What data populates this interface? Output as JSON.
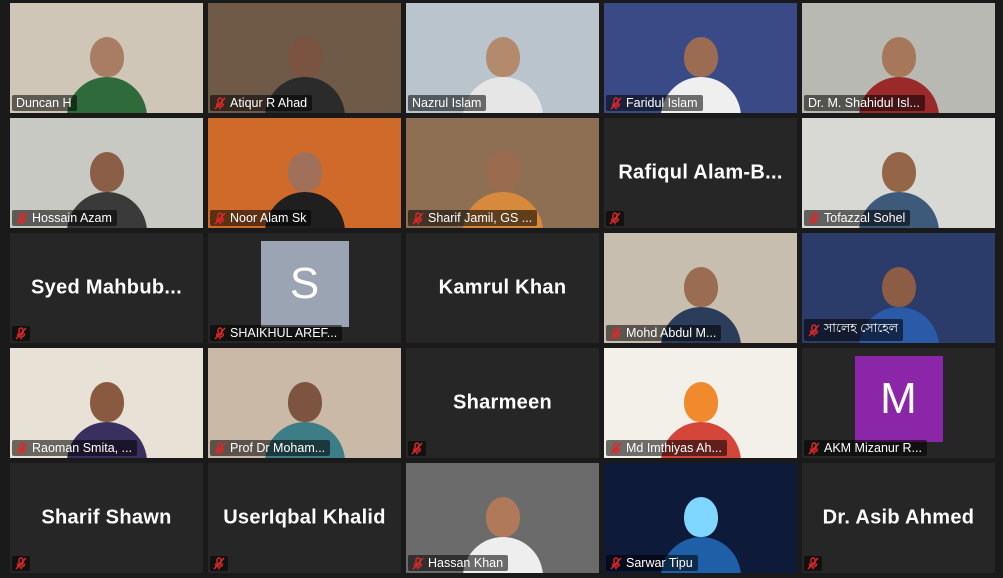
{
  "meeting": {
    "colors": {
      "active_speaker_border": "#d6e07a",
      "muted_icon": "#e02828",
      "tile_background": "#262626"
    },
    "participants": [
      {
        "name": "Duncan H",
        "label": "Duncan H",
        "video": true,
        "muted": false,
        "active_speaker": true,
        "scene": {
          "bg": "#cfc6b8",
          "head": "#a97c64",
          "body": "#2f6a3a"
        }
      },
      {
        "name": "Atiqur R Ahad",
        "label": "Atiqur R Ahad",
        "video": true,
        "muted": true,
        "scene": {
          "bg": "#6f5a48",
          "head": "#7a5440",
          "body": "#2b2b2b"
        }
      },
      {
        "name": "Nazrul Islam",
        "label": "Nazrul Islam",
        "video": true,
        "muted": false,
        "scene": {
          "bg": "#b9c4cc",
          "head": "#b48a6c",
          "body": "#e6e6e6"
        }
      },
      {
        "name": "Faridul Islam",
        "label": "Faridul Islam",
        "video": true,
        "muted": true,
        "scene": {
          "bg": "#3a4a86",
          "head": "#9b6c52",
          "body": "#efefef"
        }
      },
      {
        "name": "Dr. M. Shahidul Isl...",
        "label": "Dr. M. Shahidul Isl...",
        "video": true,
        "muted": false,
        "scene": {
          "bg": "#b8b9b2",
          "head": "#a67758",
          "body": "#9a2a2a"
        }
      },
      {
        "name": "Hossain Azam",
        "label": "Hossain Azam",
        "video": true,
        "muted": true,
        "scene": {
          "bg": "#c9c9c4",
          "head": "#8b5e47",
          "body": "#3a3a3a"
        }
      },
      {
        "name": "Noor Alam Sk",
        "label": "Noor Alam  Sk",
        "video": true,
        "muted": true,
        "scene": {
          "bg": "#d06a2a",
          "head": "#a0705a",
          "body": "#1f1f1f"
        }
      },
      {
        "name": "Sharif Jamil, GS ...",
        "label": "Sharif Jamil, GS ...",
        "video": true,
        "muted": true,
        "scene": {
          "bg": "#8e6f53",
          "head": "#9b6b4f",
          "body": "#d88a3c"
        }
      },
      {
        "name": "Rafiqul Alam-B...",
        "label": "",
        "video": false,
        "muted": true,
        "display": "Rafiqul  Alam-B..."
      },
      {
        "name": "Tofazzal Sohel",
        "label": "Tofazzal Sohel",
        "video": true,
        "muted": true,
        "scene": {
          "bg": "#d8d8d4",
          "head": "#956548",
          "body": "#3d5a7a"
        }
      },
      {
        "name": "Syed Mahbub...",
        "label": "",
        "video": false,
        "muted": true,
        "display": "Syed  Mahbub..."
      },
      {
        "name": "SHAIKHUL AREF...",
        "label": "SHAIKHUL AREF...",
        "video": false,
        "muted": true,
        "avatar_letter": "S",
        "avatar_color": "#9aa4b2"
      },
      {
        "name": "Kamrul Khan",
        "label": "",
        "video": false,
        "muted": false,
        "display": "Kamrul Khan"
      },
      {
        "name": "Mohd Abdul M...",
        "label": "Mohd Abdul M...",
        "video": true,
        "muted": true,
        "scene": {
          "bg": "#c8beb0",
          "head": "#9a6d52",
          "body": "#2c3d5c"
        }
      },
      {
        "name": "সালেহ সোহেল",
        "label": "সালেহ সোহেল",
        "video": true,
        "muted": true,
        "scene": {
          "bg": "#2b3b6a",
          "head": "#8c5c45",
          "body": "#2a5aa8"
        }
      },
      {
        "name": "Raoman Smita, ...",
        "label": "Raoman Smita, ...",
        "video": true,
        "muted": true,
        "scene": {
          "bg": "#e8e2d6",
          "head": "#8a5a40",
          "body": "#3a3060"
        }
      },
      {
        "name": "Prof Dr Moham...",
        "label": "Prof Dr Moham...",
        "video": true,
        "muted": true,
        "scene": {
          "bg": "#c9b9a6",
          "head": "#7d5440",
          "body": "#3c7d86"
        }
      },
      {
        "name": "Sharmeen",
        "label": "",
        "video": false,
        "muted": true,
        "display": "Sharmeen"
      },
      {
        "name": "Md Imthiyas Ah...",
        "label": "Md Imthiyas Ah...",
        "video": true,
        "muted": true,
        "scene": {
          "bg": "#f3efe9",
          "head": "#f08a2c",
          "body": "#d4463a"
        }
      },
      {
        "name": "AKM Mizanur R...",
        "label": "AKM Mizanur R...",
        "video": false,
        "muted": true,
        "avatar_letter": "M",
        "avatar_color": "#8b26a8"
      },
      {
        "name": "Sharif Shawn",
        "label": "",
        "video": false,
        "muted": true,
        "display": "Sharif Shawn"
      },
      {
        "name": "UserIqbal Khalid",
        "label": "",
        "video": false,
        "muted": true,
        "display": "UserIqbal Khalid"
      },
      {
        "name": "Hassan Khan",
        "label": "Hassan Khan",
        "video": true,
        "muted": true,
        "scene": {
          "bg": "#6b6b6b",
          "head": "#b07a5a",
          "body": "#eeeeee"
        }
      },
      {
        "name": "Sarwar Tipu",
        "label": "Sarwar Tipu",
        "video": true,
        "muted": true,
        "scene": {
          "bg": "#0d1a3a",
          "head": "#7fd6ff",
          "body": "#1f5fa8"
        }
      },
      {
        "name": "Dr. Asib Ahmed",
        "label": "",
        "video": false,
        "muted": true,
        "display": "Dr. Asib Ahmed"
      }
    ]
  }
}
